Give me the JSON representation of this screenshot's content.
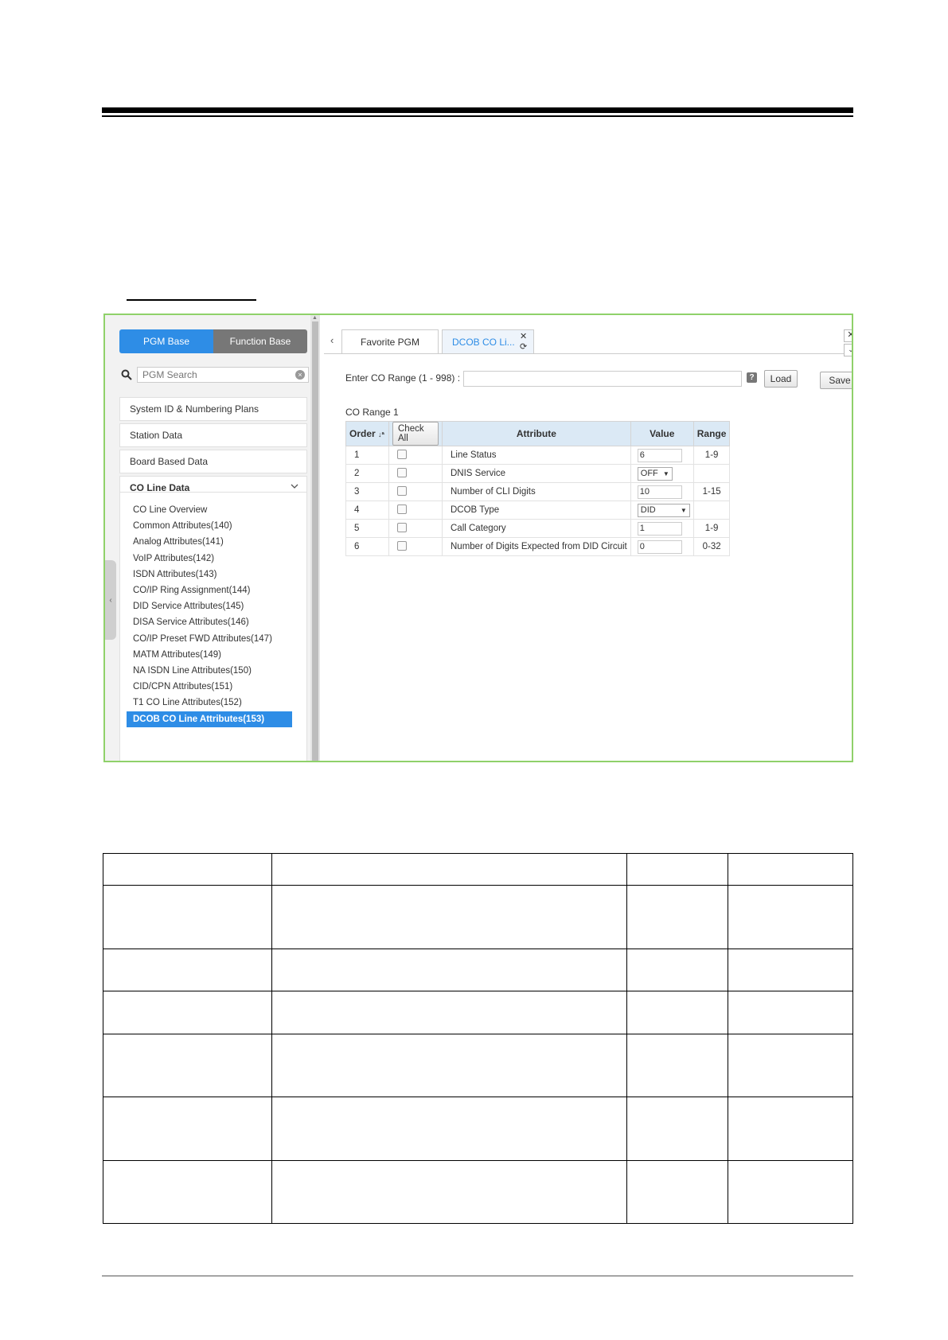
{
  "ui": {
    "toggle": {
      "pgm_base": "PGM Base",
      "function_base": "Function Base"
    },
    "search": {
      "placeholder": "PGM Search",
      "icon": "search-icon"
    },
    "menu": [
      {
        "label": "System ID & Numbering Plans"
      },
      {
        "label": "Station Data"
      },
      {
        "label": "Board Based Data"
      },
      {
        "label": "CO Line Data",
        "expanded": true
      }
    ],
    "submenu": [
      "CO Line Overview",
      "Common Attributes(140)",
      "Analog Attributes(141)",
      "VoIP Attributes(142)",
      "ISDN Attributes(143)",
      "CO/IP Ring Assignment(144)",
      "DID Service Attributes(145)",
      "DISA Service Attributes(146)",
      "CO/IP Preset FWD Attributes(147)",
      "MATM Attributes(149)",
      "NA ISDN Line Attributes(150)",
      "CID/CPN Attributes(151)",
      "T1 CO Line Attributes(152)",
      "DCOB CO Line Attributes(153)"
    ],
    "active_submenu_index": 13,
    "tabs": {
      "favorite": "Favorite PGM",
      "current": "DCOB CO Li..."
    },
    "range": {
      "label": "Enter CO Range (1 - 998) :",
      "value": "",
      "help": "?",
      "load": "Load",
      "save": "Save"
    },
    "co_range_title": "CO Range 1",
    "table": {
      "headers": {
        "order": "Order",
        "check_all": "Check All",
        "attribute": "Attribute",
        "value": "Value",
        "range": "Range"
      },
      "rows": [
        {
          "order": "1",
          "attribute": "Line Status",
          "value": "6",
          "type": "input",
          "range": "1-9"
        },
        {
          "order": "2",
          "attribute": "DNIS Service",
          "value": "OFF",
          "type": "select",
          "range": ""
        },
        {
          "order": "3",
          "attribute": "Number of CLI Digits",
          "value": "10",
          "type": "input",
          "range": "1-15"
        },
        {
          "order": "4",
          "attribute": "DCOB Type",
          "value": "DID",
          "type": "select",
          "range": ""
        },
        {
          "order": "5",
          "attribute": "Call Category",
          "value": "1",
          "type": "input",
          "range": "1-9"
        },
        {
          "order": "6",
          "attribute": "Number of Digits Expected from DID Circuit",
          "value": "0",
          "type": "input",
          "range": "0-32"
        }
      ]
    },
    "accent_color": "#2e8de6",
    "frame_color": "#8fd16a"
  }
}
